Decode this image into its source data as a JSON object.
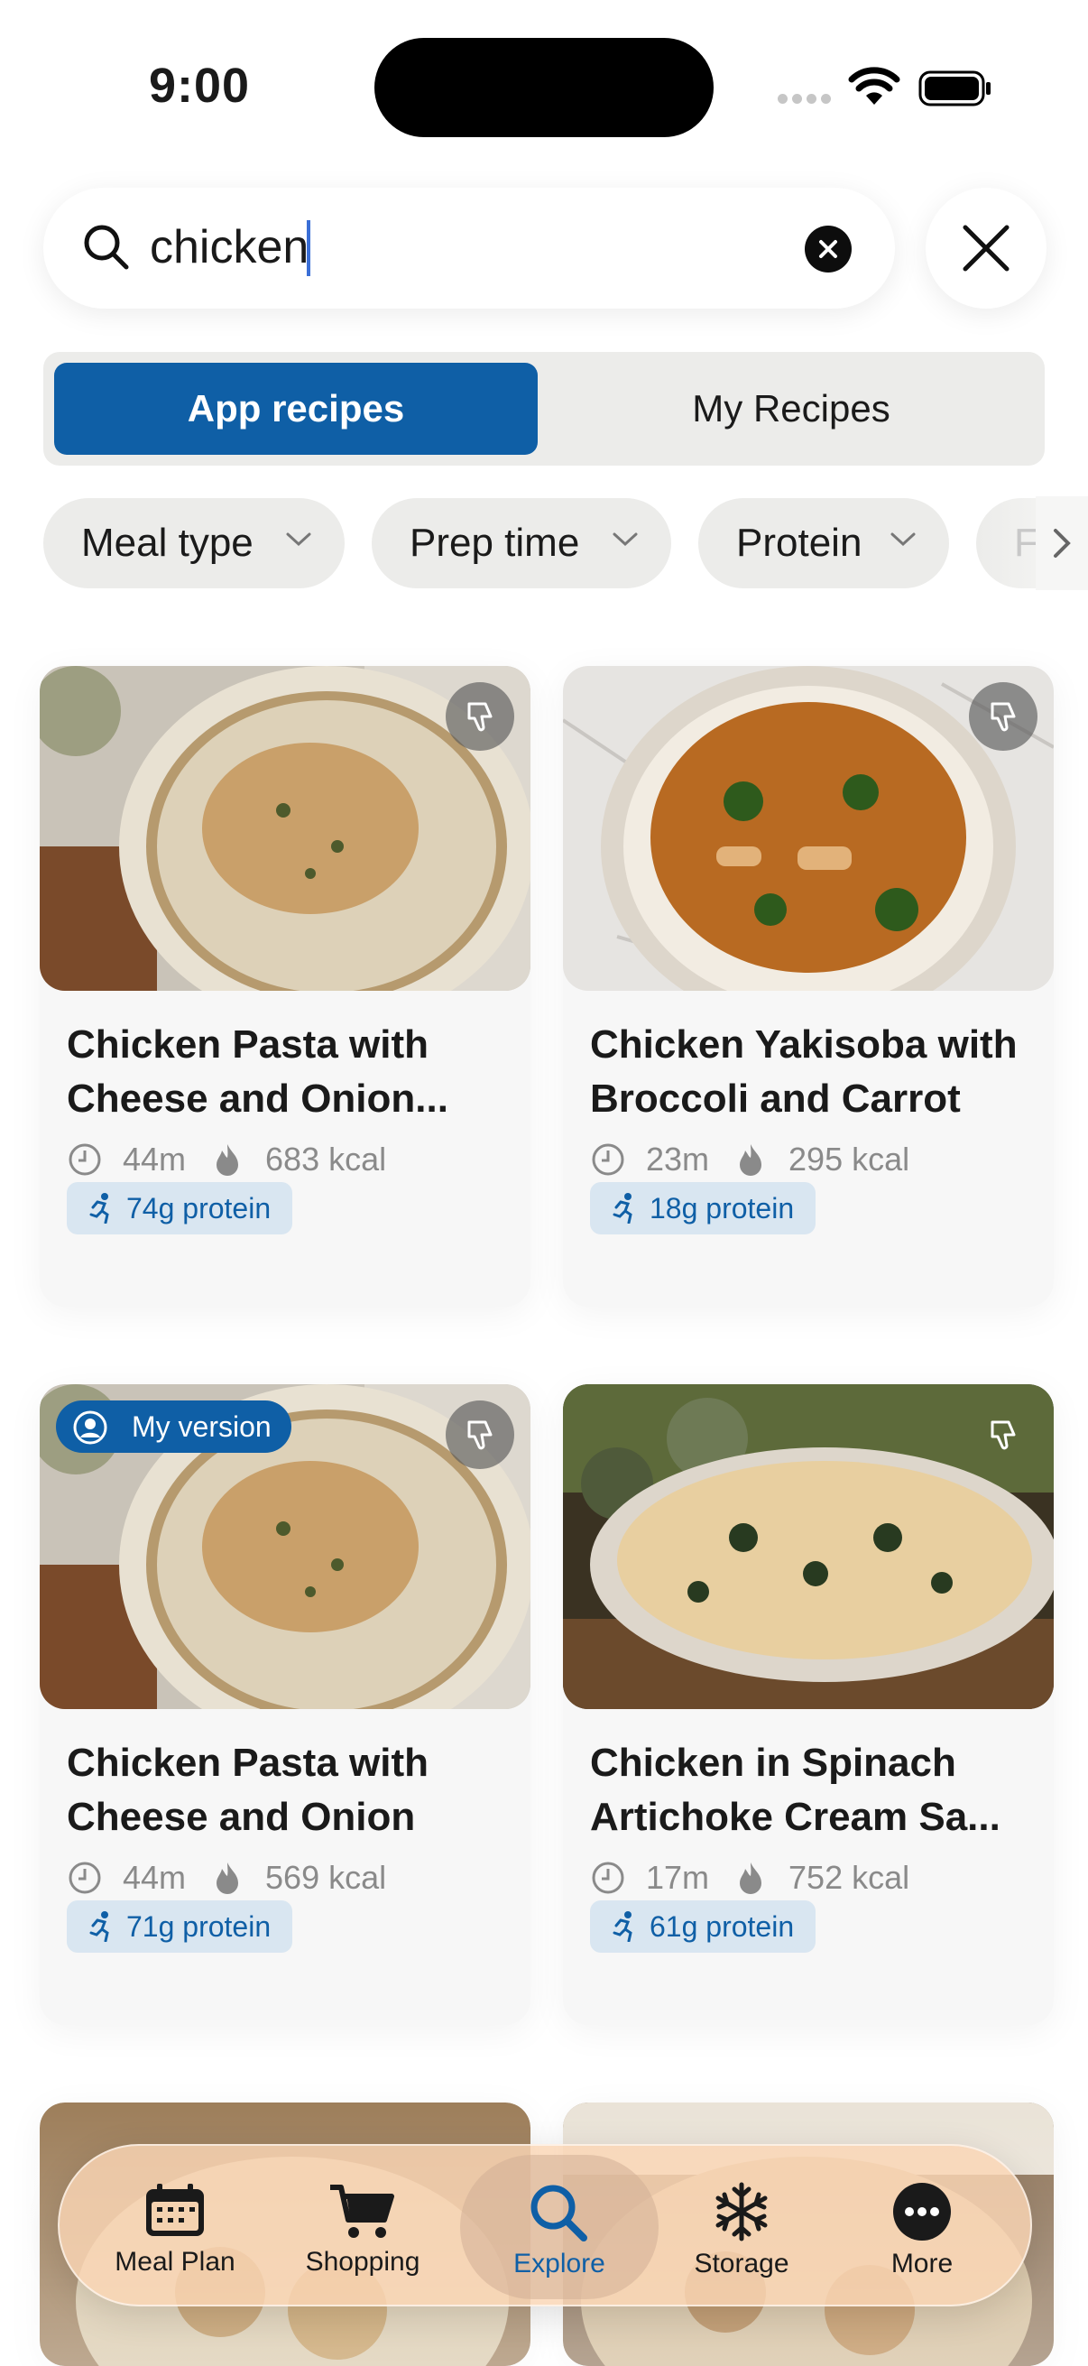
{
  "status_bar": {
    "time": "9:00"
  },
  "search": {
    "query": "chicken"
  },
  "segments": {
    "active": "App recipes",
    "inactive": "My Recipes"
  },
  "filters": [
    {
      "label": "Meal type"
    },
    {
      "label": "Prep time"
    },
    {
      "label": "Protein"
    },
    {
      "label": "F"
    }
  ],
  "recipes": [
    {
      "title_line1": "Chicken Pasta with",
      "title_line2": "Cheese and Onion...",
      "time": "44m",
      "kcal": "683 kcal",
      "protein": "74g protein",
      "badge": ""
    },
    {
      "title_line1": "Chicken Yakisoba with",
      "title_line2": "Broccoli and Carrot",
      "time": "23m",
      "kcal": "295 kcal",
      "protein": "18g protein",
      "badge": ""
    },
    {
      "title_line1": "Chicken Pasta with",
      "title_line2": "Cheese and Onion",
      "time": "44m",
      "kcal": "569 kcal",
      "protein": "71g protein",
      "badge": "My version"
    },
    {
      "title_line1": "Chicken in Spinach",
      "title_line2": "Artichoke Cream Sa...",
      "time": "17m",
      "kcal": "752 kcal",
      "protein": "61g protein",
      "badge": ""
    }
  ],
  "tabbar": [
    {
      "label": "Meal Plan",
      "icon": "calendar-icon"
    },
    {
      "label": "Shopping",
      "icon": "cart-icon"
    },
    {
      "label": "Explore",
      "icon": "search-icon",
      "active": true
    },
    {
      "label": "Storage",
      "icon": "snowflake-icon"
    },
    {
      "label": "More",
      "icon": "more-icon"
    }
  ],
  "colors": {
    "accent": "#0f5fa6",
    "protein_bg": "#d9e6f1",
    "chip_bg": "#ececea"
  }
}
